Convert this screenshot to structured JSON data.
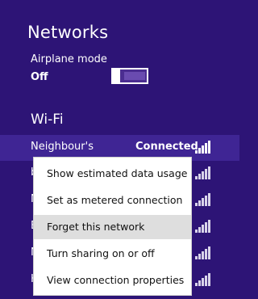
{
  "panel": {
    "title": "Networks"
  },
  "airplane_mode": {
    "label": "Airplane mode",
    "value": "Off"
  },
  "wifi": {
    "heading": "Wi-Fi"
  },
  "networks": [
    {
      "name": "Neighbour's",
      "status": "Connected",
      "signal_bars": 5
    },
    {
      "name": "b",
      "status": "",
      "signal_bars": 5
    },
    {
      "name": "N",
      "status": "",
      "signal_bars": 5
    },
    {
      "name": "E",
      "status": "",
      "signal_bars": 5
    },
    {
      "name": "N",
      "status": "",
      "signal_bars": 5
    },
    {
      "name": "H",
      "status": "",
      "signal_bars": 5
    }
  ],
  "context_menu": {
    "items": [
      {
        "label": "Show estimated data usage"
      },
      {
        "label": "Set as metered connection"
      },
      {
        "label": "Forget this network",
        "highlighted": true
      },
      {
        "label": "Turn sharing on or off"
      },
      {
        "label": "View connection properties"
      }
    ]
  },
  "colors": {
    "background": "#2d1476",
    "menu_background": "#ffffff",
    "menu_highlight": "#dedede"
  }
}
